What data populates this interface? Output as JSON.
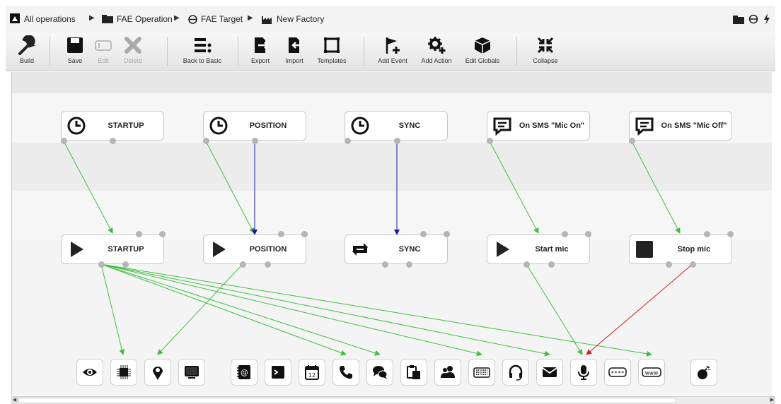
{
  "breadcrumb": {
    "items": [
      "All operations",
      "FAE Operation",
      "FAE Target",
      "New Factory"
    ]
  },
  "toolbar": {
    "build": "Build",
    "save": "Save",
    "edit": "Edit",
    "delete": "Delete",
    "back_to_basic": "Back to Basic",
    "export": "Export",
    "import": "Import",
    "templates": "Templates",
    "add_event": "Add Event",
    "add_action": "Add Action",
    "edit_globals": "Edit Globals",
    "collapse": "Collapse"
  },
  "events": [
    {
      "label": "STARTUP",
      "icon": "clock-icon"
    },
    {
      "label": "POSITION",
      "icon": "clock-icon"
    },
    {
      "label": "SYNC",
      "icon": "clock-icon"
    },
    {
      "label": "On SMS \"Mic On\"",
      "icon": "message-icon"
    },
    {
      "label": "On SMS \"Mic Off\"",
      "icon": "message-icon"
    }
  ],
  "actions": [
    {
      "label": "STARTUP",
      "icon": "play-icon"
    },
    {
      "label": "POSITION",
      "icon": "play-icon"
    },
    {
      "label": "SYNC",
      "icon": "repeat-icon"
    },
    {
      "label": "Start mic",
      "icon": "play-icon"
    },
    {
      "label": "Stop mic",
      "icon": "stop-icon"
    }
  ],
  "capabilities": [
    "eye-icon",
    "chip-icon",
    "map-pin-icon",
    "monitor-icon",
    "address-book-icon",
    "terminal-icon",
    "calendar-icon",
    "phone-icon",
    "chat-icon",
    "clipboard-icon",
    "contacts-icon",
    "keyboard-icon",
    "headset-icon",
    "mail-icon",
    "microphone-icon",
    "password-icon",
    "www-icon",
    "bomb-icon"
  ],
  "calendar_day": "12",
  "www_text": "www",
  "password_text": "****",
  "colors": {
    "trigger_link": "#3fbf3f",
    "sync_link": "#1a1aa8",
    "stop_link": "#d02020",
    "canvas_bg": "#f3f3f3",
    "band_bg": "#e9e9e9"
  }
}
